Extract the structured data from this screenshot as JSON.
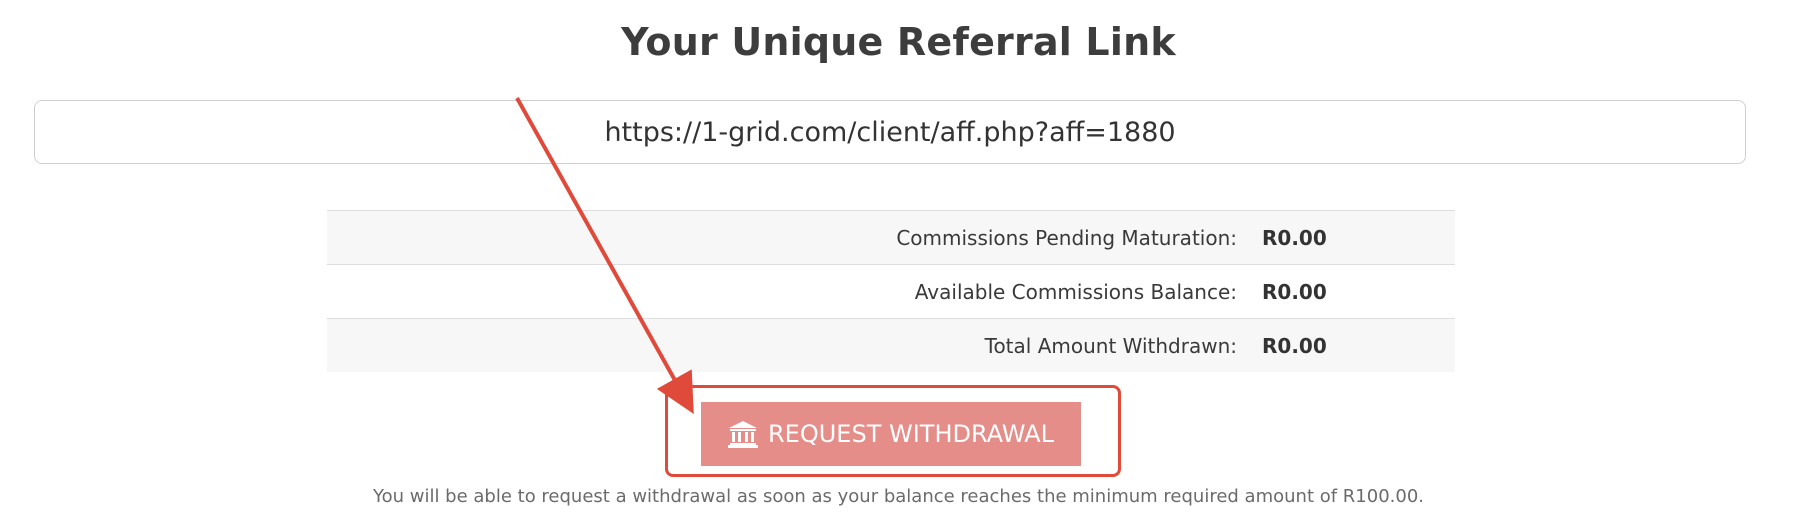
{
  "page_title": "Your Unique Referral Link",
  "referral_link": {
    "value": "https://1-grid.com/client/aff.php?aff=1880"
  },
  "stats": {
    "rows": [
      {
        "label": "Commissions Pending Maturation:",
        "value": "R0.00"
      },
      {
        "label": "Available Commissions Balance:",
        "value": "R0.00"
      },
      {
        "label": "Total Amount Withdrawn:",
        "value": "R0.00"
      }
    ]
  },
  "withdraw_button": {
    "label": "REQUEST WITHDRAWAL",
    "icon": "bank-icon",
    "color": "#e58d89"
  },
  "note": "You will be able to request a withdrawal as soon as your balance reaches the minimum required amount of R100.00.",
  "annotation": {
    "color": "#e04a3a"
  }
}
